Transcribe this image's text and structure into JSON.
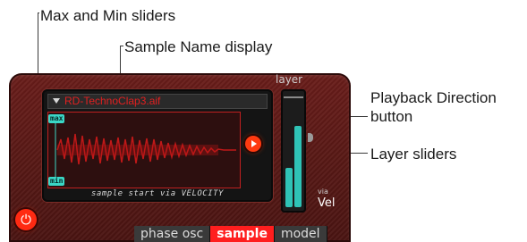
{
  "annotations": {
    "max_min": "Max and Min sliders",
    "sample_name": "Sample Name display",
    "playback": [
      "Playback Direction",
      "button"
    ],
    "layer": "Layer sliders"
  },
  "synth": {
    "sample_name": "RD-TechnoClap3.aif",
    "max_label": "max",
    "min_label": "min",
    "caption": "sample start via VELOCITY",
    "layer_title": "layer",
    "via_label": "via",
    "vel_label": "Vel",
    "power_icon": "⏻",
    "tabs": [
      {
        "label": "phase osc"
      },
      {
        "label": "sample"
      },
      {
        "label": "model"
      }
    ],
    "active_tab": "sample",
    "layer_sliders": {
      "left_level": 0.35,
      "right_level": 0.72
    }
  },
  "colors": {
    "panel": "#571815",
    "accent_red": "#ff1e1e",
    "teal": "#3ad7c6",
    "sample_text": "#e02020"
  }
}
